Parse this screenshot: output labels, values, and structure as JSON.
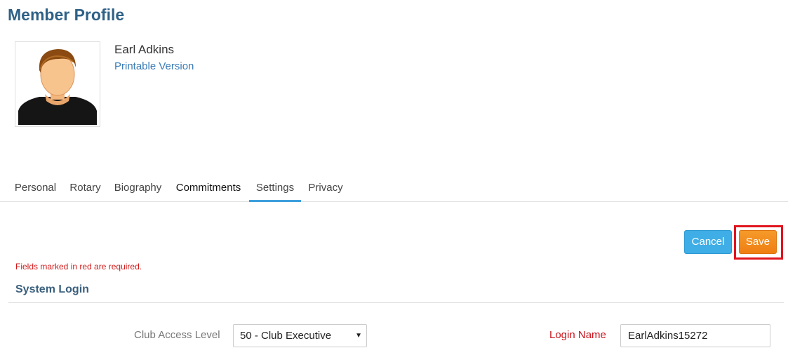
{
  "page": {
    "title": "Member Profile"
  },
  "member": {
    "name": "Earl Adkins",
    "printable_link": "Printable Version",
    "avatar_icon": "person-avatar-icon"
  },
  "tabs": [
    {
      "label": "Personal"
    },
    {
      "label": "Rotary"
    },
    {
      "label": "Biography"
    },
    {
      "label": "Commitments"
    },
    {
      "label": "Settings"
    },
    {
      "label": "Privacy"
    }
  ],
  "active_tab": "Settings",
  "actions": {
    "cancel_label": "Cancel",
    "save_label": "Save"
  },
  "form": {
    "required_note": "Fields marked in red are required.",
    "section_title": "System Login",
    "club_access": {
      "label": "Club Access Level",
      "selected": "50 - Club Executive"
    },
    "login_name": {
      "label": "Login Name",
      "value": "EarlAdkins15272"
    }
  },
  "colors": {
    "title": "#2e6187",
    "link": "#3a7bb5",
    "tab_active": "#3ea0dc",
    "cancel": "#3faee6",
    "save": "#ef7f13",
    "required": "#c8141b",
    "highlight": "#e0141e"
  }
}
